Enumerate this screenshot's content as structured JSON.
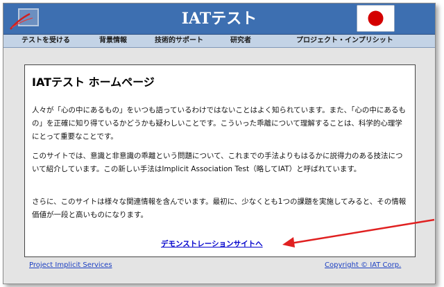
{
  "header": {
    "title": "IATテスト"
  },
  "nav": {
    "items": [
      "テストを受ける",
      "背景情報",
      "技術的サポート",
      "研究者",
      "プロジェクト・インプリシット"
    ]
  },
  "main": {
    "heading": "IATテスト ホームページ",
    "paragraphs": [
      "人々が「心の中にあるもの」をいつも語っているわけではないことはよく知られています。また、「心の中にあるもの」を正確に知り得ているかどうかも疑わしいことです。こういった乖離について理解することは、科学的心理学にとって重要なことです。",
      "このサイトでは、意識と非意識の乖離という問題について、これまでの手法よりもはるかに説得力のある技法について紹介しています。この新しい手法はImplicit Association Test（略してIAT）と呼ばれています。",
      "さらに、このサイトは様々な関連情報を含んでいます。最初に、少なくとも1つの課題を実施してみると、その情報価値が一段と高いものになります。"
    ],
    "demo_link": "デモンストレーションサイトへ"
  },
  "footer": {
    "left_link": "Project Implicit Services",
    "right_link": "Copyright © IAT Corp."
  },
  "colors": {
    "header_bg": "#3d6fb1",
    "nav_bg": "#c3d3e6",
    "page_bg": "#e4e4e4",
    "link": "#0000cc",
    "arrow": "#e02020"
  }
}
